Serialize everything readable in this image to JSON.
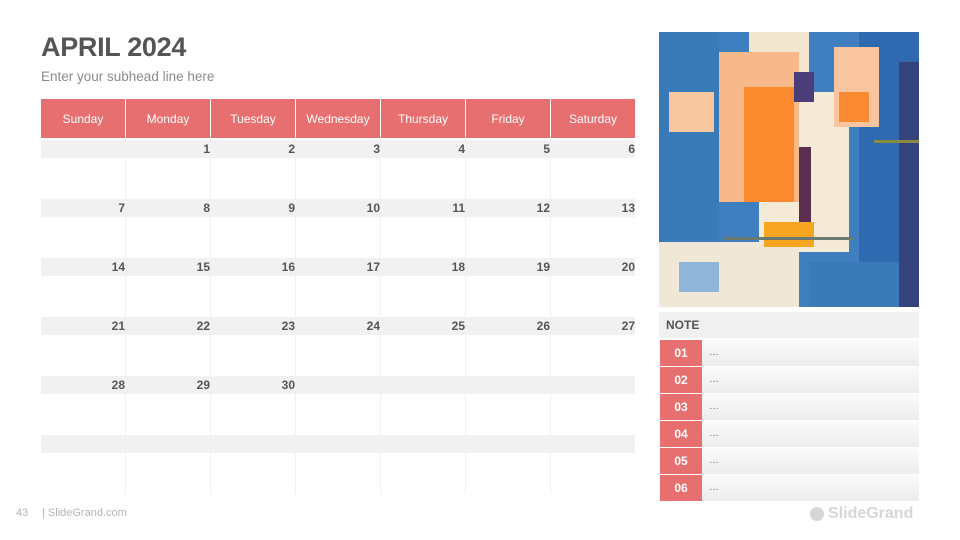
{
  "header": {
    "title": "APRIL 2024",
    "subhead": "Enter your subhead line here"
  },
  "calendar": {
    "weekdays": [
      "Sunday",
      "Monday",
      "Tuesday",
      "Wednesday",
      "Thursday",
      "Friday",
      "Saturday"
    ],
    "weeks": [
      [
        "",
        "1",
        "2",
        "3",
        "4",
        "5",
        "6"
      ],
      [
        "7",
        "8",
        "9",
        "10",
        "11",
        "12",
        "13"
      ],
      [
        "14",
        "15",
        "16",
        "17",
        "18",
        "19",
        "20"
      ],
      [
        "21",
        "22",
        "23",
        "24",
        "25",
        "26",
        "27"
      ],
      [
        "28",
        "29",
        "30",
        "",
        "",
        "",
        ""
      ],
      [
        "",
        "",
        "",
        "",
        "",
        "",
        ""
      ]
    ]
  },
  "photo": {
    "description": "abstract-painting-blue-orange",
    "icon": "image-icon"
  },
  "notes": {
    "title": "NOTE",
    "items": [
      {
        "num": "01",
        "text": "…"
      },
      {
        "num": "02",
        "text": "…"
      },
      {
        "num": "03",
        "text": "…"
      },
      {
        "num": "04",
        "text": "…"
      },
      {
        "num": "05",
        "text": "…"
      },
      {
        "num": "06",
        "text": "…"
      }
    ]
  },
  "footer": {
    "page_number": "43",
    "site": "| SlideGrand.com",
    "logo_text": "SlideGrand"
  },
  "colors": {
    "accent": "#e86f6f",
    "band": "#f1f1f1",
    "text_dark": "#555555"
  }
}
